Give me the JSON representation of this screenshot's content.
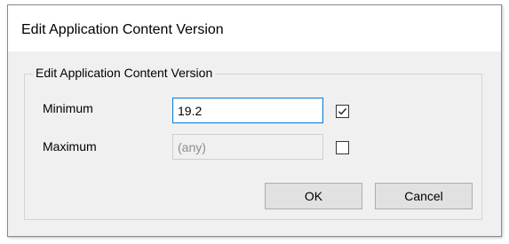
{
  "dialog": {
    "title": "Edit Application Content Version"
  },
  "group": {
    "legend": "Edit Application Content Version"
  },
  "fields": {
    "minimum": {
      "label": "Minimum",
      "value": "19.2",
      "checked": true
    },
    "maximum": {
      "label": "Maximum",
      "value": "(any)",
      "checked": false
    }
  },
  "buttons": {
    "ok_label": "OK",
    "cancel_label": "Cancel"
  }
}
